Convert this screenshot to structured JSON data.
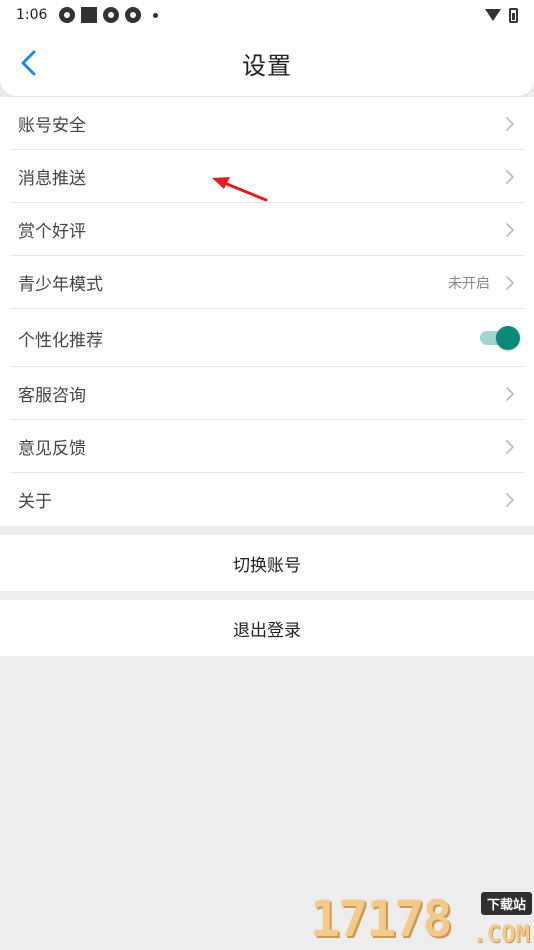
{
  "status_bar": {
    "time": "1:06",
    "icons": [
      "app-notification-icon",
      "square-notification-icon",
      "app-notification-icon",
      "app-notification-icon",
      "dot-icon"
    ],
    "right_icons": [
      "wifi-icon",
      "battery-icon"
    ]
  },
  "header": {
    "title": "设置",
    "back_icon": "chevron-left-icon",
    "accent_color": "#1e88e5"
  },
  "settings": {
    "items": [
      {
        "label": "账号安全"
      },
      {
        "label": "消息推送"
      },
      {
        "label": "赏个好评"
      },
      {
        "label": "青少年模式",
        "value": "未开启"
      },
      {
        "label": "个性化推荐",
        "toggle": true
      },
      {
        "label": "客服咨询"
      },
      {
        "label": "意见反馈"
      },
      {
        "label": "关于"
      }
    ]
  },
  "actions": {
    "switch_account": "切换账号",
    "logout": "退出登录"
  },
  "toggle_color": "#0b8a7a",
  "annotation_color": "#e02020",
  "watermark": {
    "digits": "17178",
    "badge": "下载站",
    "domain": ".COM"
  }
}
